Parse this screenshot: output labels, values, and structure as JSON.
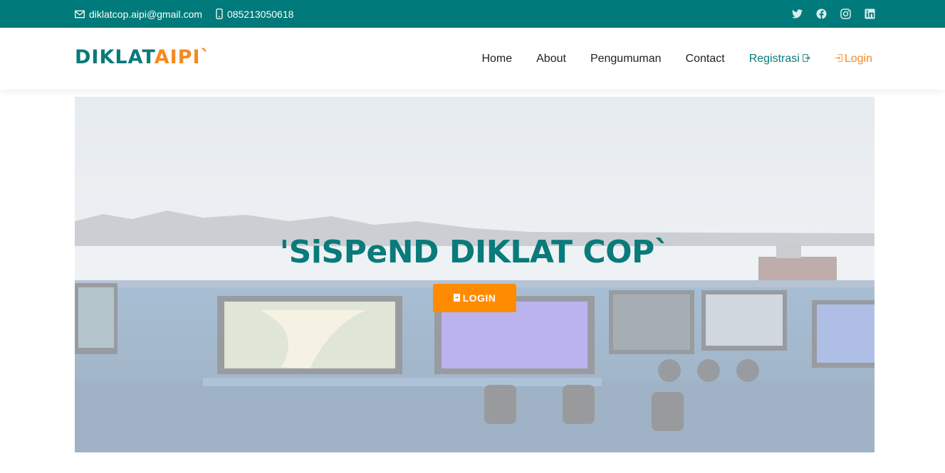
{
  "topbar": {
    "email": "diklatcop.aipi@gmail.com",
    "phone": "085213050618",
    "social_icons": [
      "twitter-icon",
      "facebook-icon",
      "instagram-icon",
      "linkedin-icon"
    ]
  },
  "header": {
    "logo_primary": "DIKLAT",
    "logo_accent": "AIPI`",
    "nav": {
      "home": "Home",
      "about": "About",
      "pengumuman": "Pengumuman",
      "contact": "Contact",
      "registrasi": "Registrasi",
      "login": "Login"
    }
  },
  "hero": {
    "title": "'SiSPeND DIKLAT COP`",
    "button_label": "LOGIN"
  },
  "colors": {
    "brand_teal": "#007a7a",
    "brand_orange": "#f58a1f",
    "button_orange": "#ff8c00"
  }
}
